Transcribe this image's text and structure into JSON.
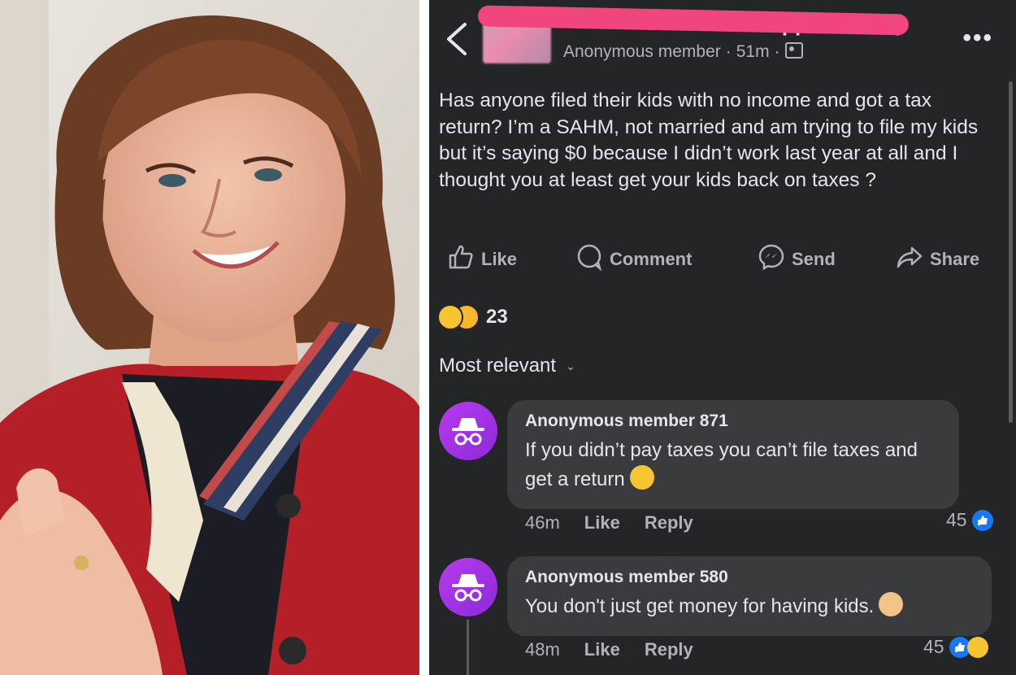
{
  "photo": {
    "description_icon": "woman-photo"
  },
  "header": {
    "title_tail": "Support Group",
    "author": "Anonymous member",
    "time": "51m"
  },
  "post": {
    "text": "Has anyone filed their kids with no income and got a tax return? I’m a SAHM, not married  and am trying to file my kids but it’s saying $0 because I didn’t work last year at all and I thought you at least get your kids back on taxes ?"
  },
  "actions": {
    "like": "Like",
    "comment": "Comment",
    "send": "Send",
    "share": "Share"
  },
  "reactions": {
    "count": "23"
  },
  "sort": {
    "label": "Most relevant"
  },
  "comments": [
    {
      "author": "Anonymous member 871",
      "text": "If you didn’t pay taxes you can’t file taxes and get a return",
      "time": "46m",
      "like": "Like",
      "reply": "Reply",
      "count": "45"
    },
    {
      "author": "Anonymous member 580",
      "text": "You don't just get money for having kids.",
      "time": "48m",
      "like": "Like",
      "reply": "Reply",
      "count": "45"
    }
  ],
  "colors": {
    "background": "#242526",
    "bubble": "#3a3b3c",
    "text": "#e4e6eb",
    "muted": "#b0b3b8",
    "avatar": "#9b30e4",
    "like_blue": "#1877f2",
    "redaction": "#f0457f"
  }
}
